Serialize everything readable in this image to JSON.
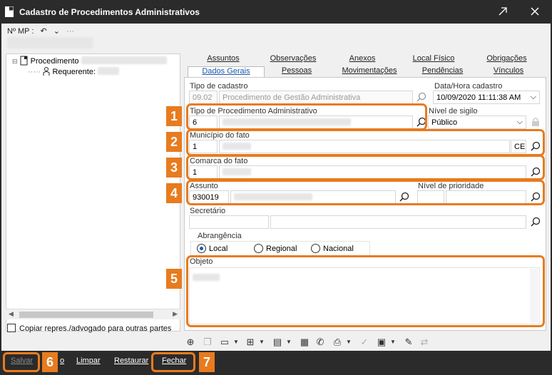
{
  "window": {
    "title": "Cadastro de Procedimentos Administrativos"
  },
  "header": {
    "mp_label": "Nº MP :"
  },
  "tree": {
    "root_label": "Procedimento",
    "child_label": "Requerente:"
  },
  "copiar_label": "Copiar repres./advogado para outras partes",
  "tabs": {
    "row1": [
      "Assuntos",
      "Observações",
      "Anexos",
      "Local Físico",
      "Obrigações"
    ],
    "row2": [
      "Dados Gerais",
      "Pessoas",
      "Movimentações",
      "Pendências",
      "Vínculos"
    ]
  },
  "form": {
    "tipo_cadastro_label": "Tipo de cadastro",
    "tipo_cadastro_code": "09.02",
    "tipo_cadastro_value": "Procedimento de Gestão Administrativa",
    "data_hora_label": "Data/Hora cadastro",
    "data_hora_value": "10/09/2020 11:11:38 AM",
    "tipo_proc_label": "Tipo de Procedimento Administrativo",
    "tipo_proc_code": "6",
    "nivel_sigilo_label": "Nível de sigilo",
    "nivel_sigilo_value": "Público",
    "municipio_label": "Município do fato",
    "municipio_code": "1",
    "municipio_uf": "CE",
    "comarca_label": "Comarca do fato",
    "comarca_code": "1",
    "assunto_label": "Assunto",
    "assunto_code": "930019",
    "nivel_prioridade_label": "Nível de prioridade",
    "secretario_label": "Secretário",
    "abrangencia_label": "Abrangência",
    "abrangencia_options": [
      "Local",
      "Regional",
      "Nacional"
    ],
    "abrangencia_selected": "Local",
    "objeto_label": "Objeto"
  },
  "badges": [
    "1",
    "2",
    "3",
    "4",
    "5",
    "6",
    "7"
  ],
  "bottom_buttons": {
    "salvar": "Salvar",
    "partial": "o",
    "limpar": "Limpar",
    "restaurar": "Restaurar",
    "fechar": "Fechar"
  },
  "colors": {
    "accent": "#e87b1e",
    "titlebar": "#2b2b2b",
    "tab_active_text": "#1a56b0"
  }
}
